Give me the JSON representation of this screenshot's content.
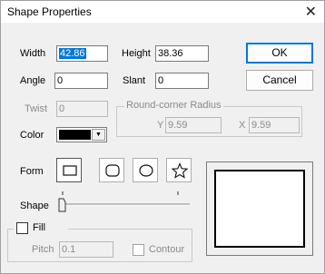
{
  "window": {
    "title": "Shape Properties",
    "close_glyph": "✕"
  },
  "fields": {
    "width": {
      "label": "Width",
      "value": "42.86"
    },
    "height": {
      "label": "Height",
      "value": "38.36"
    },
    "angle": {
      "label": "Angle",
      "value": "0"
    },
    "slant": {
      "label": "Slant",
      "value": "0"
    },
    "twist": {
      "label": "Twist",
      "value": "0"
    }
  },
  "buttons": {
    "ok": "OK",
    "cancel": "Cancel"
  },
  "round_corner": {
    "label": "Round-corner Radius",
    "y_label": "Y",
    "y_value": "9.59",
    "x_label": "X",
    "x_value": "9.59"
  },
  "color": {
    "label": "Color",
    "value": "#000000"
  },
  "form": {
    "label": "Form",
    "options": [
      "rectangle-icon",
      "rounded-rectangle-icon",
      "ellipse-icon",
      "star-icon"
    ],
    "selected": "rectangle-icon"
  },
  "shape": {
    "label": "Shape"
  },
  "fill": {
    "label": "Fill",
    "checked": false,
    "pitch_label": "Pitch",
    "pitch_value": "0.1",
    "contour_label": "Contour",
    "contour_checked": false
  }
}
